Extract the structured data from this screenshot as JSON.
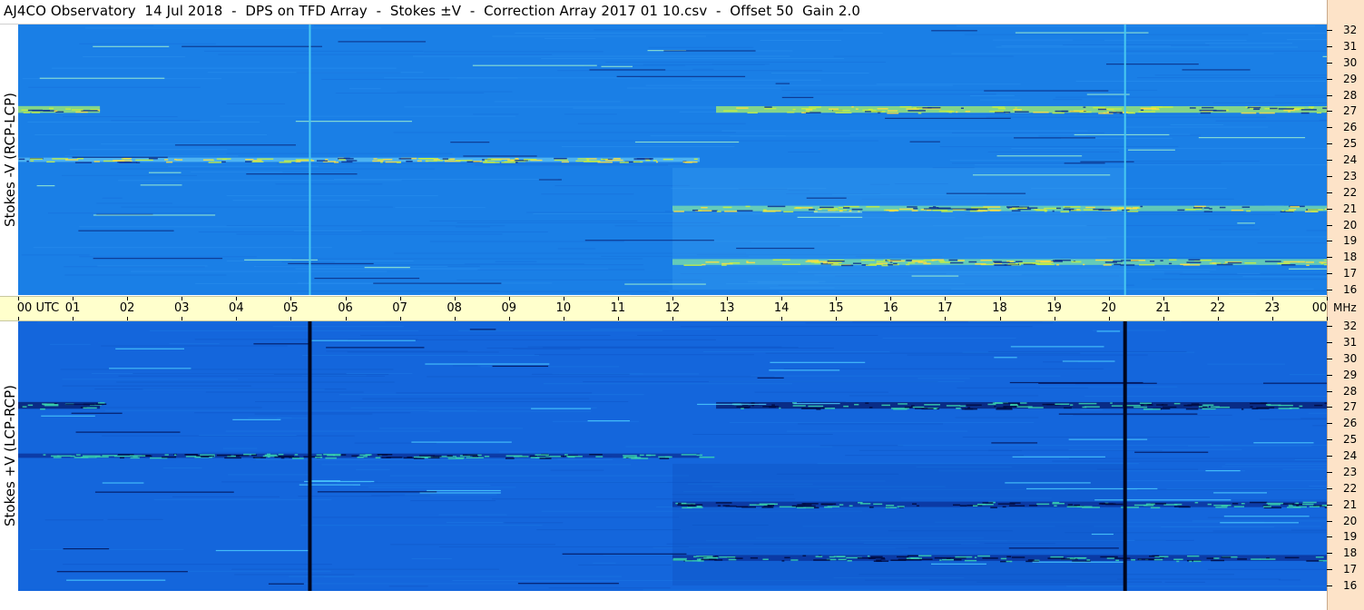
{
  "title": "AJ4CO Observatory  14 Jul 2018  -  DPS on TFD Array  -  Stokes ±V  -  Correction Array 2017 01 10.csv  -  Offset 50  Gain 2.0",
  "panels": {
    "top_ylabel": "Stokes -V (RCP-LCP)",
    "bottom_ylabel": "Stokes +V (LCP-RCP)"
  },
  "time_axis": {
    "labels": [
      "00 UTC",
      "01",
      "02",
      "03",
      "04",
      "05",
      "06",
      "07",
      "08",
      "09",
      "10",
      "11",
      "12",
      "13",
      "14",
      "15",
      "16",
      "17",
      "18",
      "19",
      "20",
      "21",
      "22",
      "23",
      "00"
    ],
    "unit": "MHz"
  },
  "freq_axis": {
    "labels": [
      "32",
      "31",
      "30",
      "29",
      "28",
      "27",
      "26",
      "25",
      "24",
      "23",
      "22",
      "21",
      "20",
      "19",
      "18",
      "17",
      "16"
    ]
  },
  "colors": {
    "background_blue": "#1a7fe6",
    "timebar": "#ffffcc",
    "right_strip": "#fde3c8"
  },
  "chart_data": {
    "type": "heatmap",
    "title": "AJ4CO Observatory  14 Jul 2018  -  DPS on TFD Array  -  Stokes ±V  -  Correction Array 2017 01 10.csv  -  Offset 50  Gain 2.0",
    "x_range_utc_hours": [
      0,
      24
    ],
    "y_range_mhz": [
      16,
      32
    ],
    "panels": [
      "Stokes -V (RCP-LCP)",
      "Stokes +V (LCP-RCP)"
    ],
    "features": [
      {
        "panel": "both",
        "kind": "vertical_line",
        "time_utc": 5.35
      },
      {
        "panel": "both",
        "kind": "vertical_line",
        "time_utc": 20.3
      },
      {
        "panel": "both",
        "kind": "band",
        "freq_mhz": 27.1,
        "time_utc": [
          0,
          1.5
        ],
        "intensity": 0.9
      },
      {
        "panel": "both",
        "kind": "band",
        "freq_mhz": 27.1,
        "time_utc": [
          12.8,
          24
        ],
        "intensity": 0.85
      },
      {
        "panel": "both",
        "kind": "band",
        "freq_mhz": 21.0,
        "time_utc": [
          12,
          24
        ],
        "intensity": 0.6
      },
      {
        "panel": "both",
        "kind": "band",
        "freq_mhz": 17.7,
        "time_utc": [
          12,
          24
        ],
        "intensity": 0.7
      },
      {
        "panel": "both",
        "kind": "band",
        "freq_mhz": 24.0,
        "time_utc": [
          0,
          12.5
        ],
        "intensity": 0.35
      }
    ]
  }
}
